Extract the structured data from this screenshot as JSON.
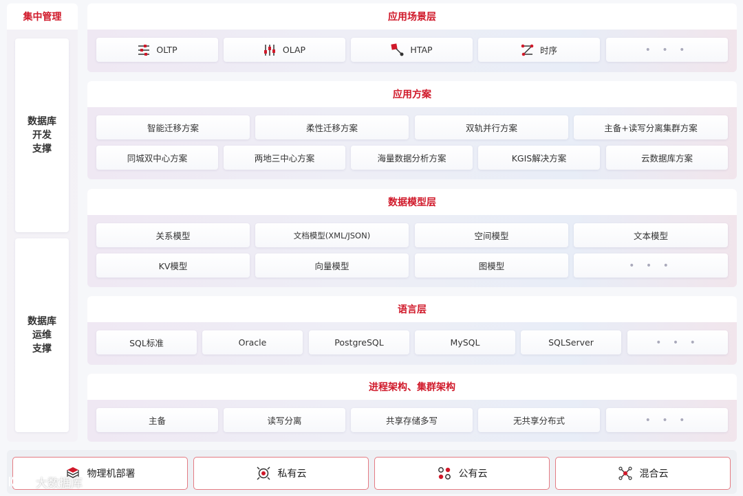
{
  "left": {
    "title": "集中管理",
    "dev_support": [
      "数据库",
      "开发",
      "支撑"
    ],
    "ops_support": [
      "数据库",
      "运维",
      "支撑"
    ]
  },
  "layers": {
    "scene": {
      "title": "应用场景层",
      "items": [
        {
          "label": "OLTP",
          "icon": "sliders-icon"
        },
        {
          "label": "OLAP",
          "icon": "equalizer-icon"
        },
        {
          "label": "HTAP",
          "icon": "hybrid-icon"
        },
        {
          "label": "时序",
          "icon": "timeseries-icon"
        },
        {
          "label": "• • •"
        }
      ]
    },
    "solution": {
      "title": "应用方案",
      "row1": [
        "智能迁移方案",
        "柔性迁移方案",
        "双轨并行方案",
        "主备+读写分离集群方案"
      ],
      "row2": [
        "同城双中心方案",
        "两地三中心方案",
        "海量数据分析方案",
        "KGIS解决方案",
        "云数据库方案"
      ]
    },
    "model": {
      "title": "数据模型层",
      "row1": [
        "关系模型",
        "文档模型(XML/JSON)",
        "空间模型",
        "文本模型"
      ],
      "row2": [
        "KV模型",
        "向量模型",
        "图模型",
        "• • •"
      ]
    },
    "language": {
      "title": "语言层",
      "items": [
        "SQL标准",
        "Oracle",
        "PostgreSQL",
        "MySQL",
        "SQLServer",
        "• • •"
      ]
    },
    "arch": {
      "title": "进程架构、集群架构",
      "items": [
        "主备",
        "读写分离",
        "共享存储多写",
        "无共享分布式",
        "• • •"
      ]
    }
  },
  "deploy": [
    {
      "label": "物理机部署",
      "icon": "server-stack-icon"
    },
    {
      "label": "私有云",
      "icon": "target-icon"
    },
    {
      "label": "公有云",
      "icon": "nodes-icon"
    },
    {
      "label": "混合云",
      "icon": "network-icon"
    }
  ],
  "watermark": "大数据库",
  "colors": {
    "accent": "#d0192a",
    "border": "#e47a82"
  }
}
